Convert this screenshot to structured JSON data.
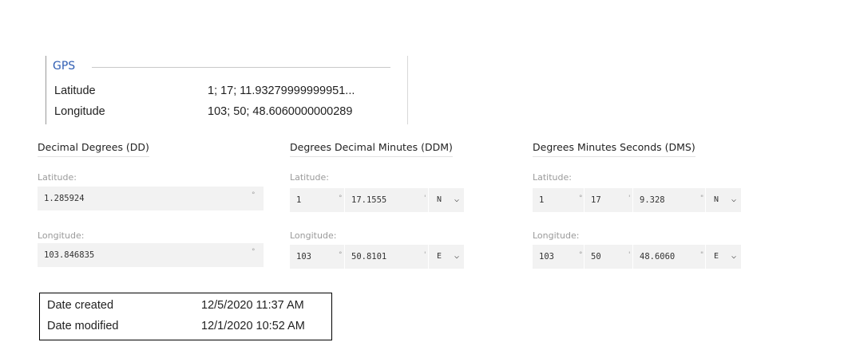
{
  "gps": {
    "title": "GPS",
    "latitude_label": "Latitude",
    "latitude_value": "1; 17; 11.93279999999951...",
    "longitude_label": "Longitude",
    "longitude_value": "103; 50; 48.6060000000289"
  },
  "dd": {
    "title": "Decimal Degrees (DD)",
    "lat_label": "Latitude:",
    "lat_value": "1.285924",
    "lon_label": "Longitude:",
    "lon_value": "103.846835",
    "deg_symbol": "°"
  },
  "ddm": {
    "title": "Degrees Decimal Minutes (DDM)",
    "lat_label": "Latitude:",
    "lat_deg": "1",
    "lat_min": "17.1555",
    "lat_dir": "N",
    "lon_label": "Longitude:",
    "lon_deg": "103",
    "lon_min": "50.8101",
    "lon_dir": "E",
    "deg_symbol": "°",
    "min_symbol": "'"
  },
  "dms": {
    "title": "Degrees Minutes Seconds (DMS)",
    "lat_label": "Latitude:",
    "lat_deg": "1",
    "lat_min": "17",
    "lat_sec": "9.328",
    "lat_dir": "N",
    "lon_label": "Longitude:",
    "lon_deg": "103",
    "lon_min": "50",
    "lon_sec": "48.6060",
    "lon_dir": "E",
    "deg_symbol": "°",
    "min_symbol": "'",
    "sec_symbol": "\""
  },
  "dates": {
    "created_label": "Date created",
    "created_value": "12/5/2020 11:37 AM",
    "modified_label": "Date modified",
    "modified_value": "12/1/2020 10:52 AM"
  },
  "icons": {
    "dropdown": "chevron-down-icon"
  }
}
